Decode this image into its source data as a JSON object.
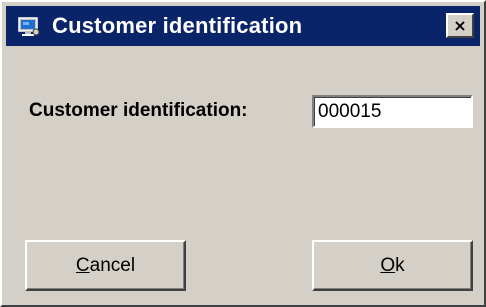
{
  "window": {
    "title": "Customer identification",
    "close_label": "×"
  },
  "form": {
    "label": "Customer identification:",
    "value": "000015"
  },
  "buttons": {
    "cancel": {
      "mnemonic": "C",
      "rest": "ancel"
    },
    "ok": {
      "mnemonic": "O",
      "rest": "k"
    }
  },
  "colors": {
    "titlebar": "#0a246a",
    "face": "#d4d0c8"
  },
  "icons": {
    "app": "app-window-icon",
    "close": "close-icon"
  }
}
